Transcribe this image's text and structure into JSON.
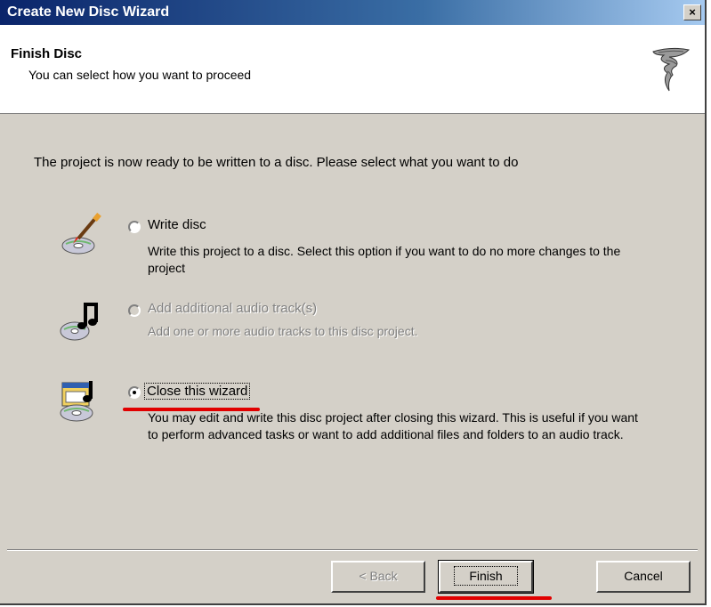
{
  "window": {
    "title": "Create New Disc Wizard",
    "close_glyph": "×"
  },
  "header": {
    "title": "Finish Disc",
    "subtitle": "You can select how you want to proceed",
    "icon": "wizard-tornado-icon"
  },
  "intro": "The project is now ready to be written to a disc. Please select what you want to do",
  "options": [
    {
      "label": "Write disc",
      "description": "Write this project to a disc. Select this option if you want to do no more changes to the project",
      "selected": false,
      "enabled": true,
      "icon": "write-disc-icon"
    },
    {
      "label": "Add additional audio track(s)",
      "description": "Add one or more audio tracks to this disc project.",
      "selected": false,
      "enabled": false,
      "icon": "audio-note-disc-icon"
    },
    {
      "label": "Close this wizard",
      "description": "You may edit and write this disc project after closing this wizard. This is useful if you want to perform advanced tasks or want to add additional files and folders to an audio track.",
      "selected": true,
      "enabled": true,
      "icon": "close-wizard-disc-icon"
    }
  ],
  "buttons": {
    "back": "< Back",
    "finish": "Finish",
    "cancel": "Cancel"
  },
  "annotation_color": "#e10000"
}
